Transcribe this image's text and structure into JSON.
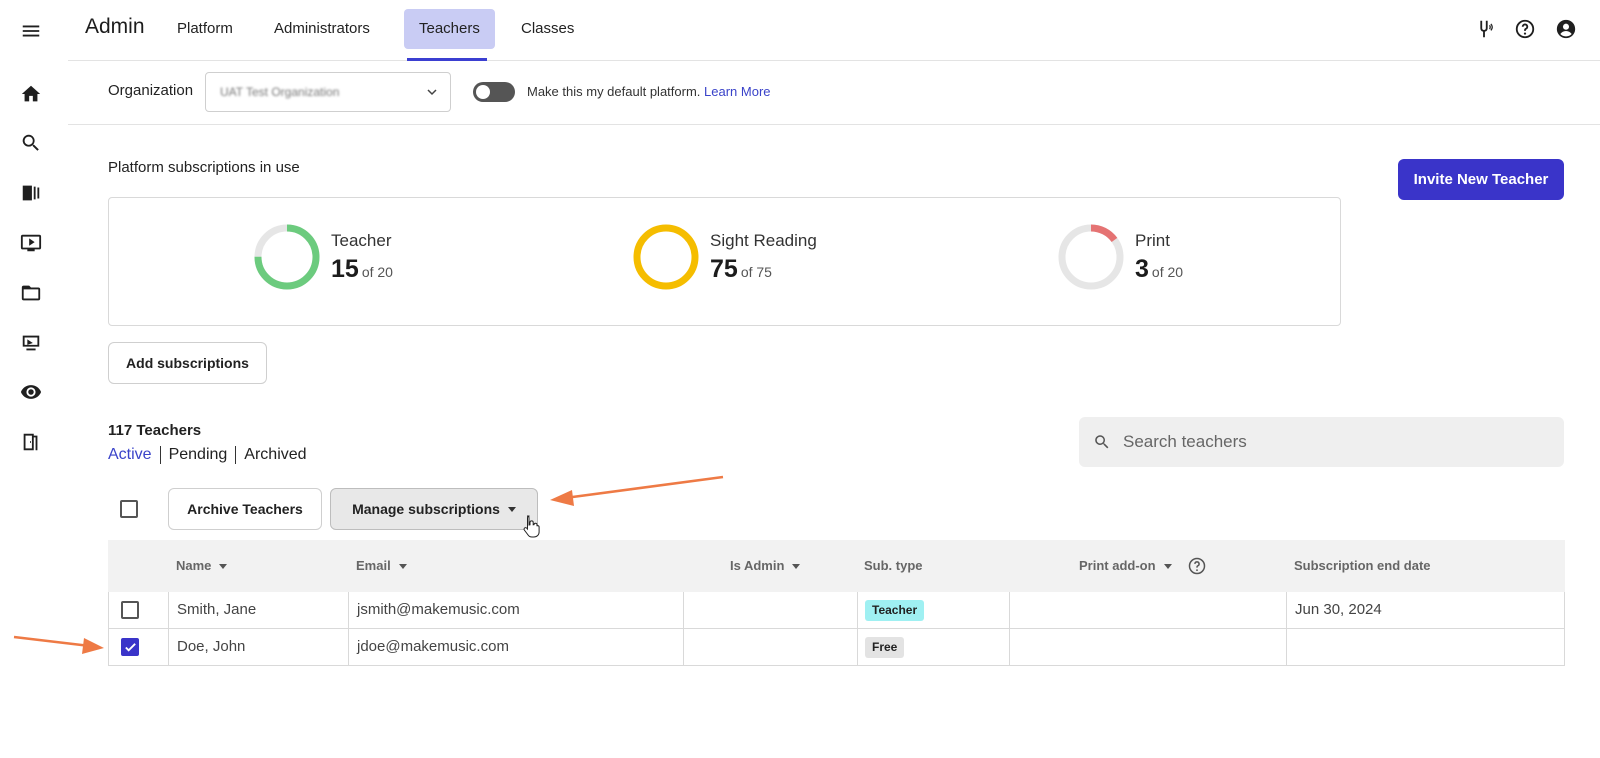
{
  "header": {
    "app_title": "Admin",
    "tabs": [
      {
        "label": "Platform"
      },
      {
        "label": "Administrators"
      },
      {
        "label": "Teachers",
        "active": true
      },
      {
        "label": "Classes"
      }
    ],
    "icons": [
      "tuning-fork-icon",
      "help-icon",
      "account-icon"
    ]
  },
  "sidebar": {
    "icons": [
      "menu-icon",
      "home-icon",
      "search-icon",
      "library-icon",
      "video-icon",
      "folder-icon",
      "classroom-icon",
      "eye-icon",
      "exit-door-icon"
    ]
  },
  "org": {
    "label": "Organization",
    "selected": "UAT Test Organization",
    "default_text": "Make this my default platform.",
    "learn_more": "Learn More",
    "default_toggle_on": false
  },
  "subscriptions": {
    "title": "Platform subscriptions in use",
    "invite_button": "Invite New Teacher",
    "add_button": "Add subscriptions",
    "meters": [
      {
        "name": "Teacher",
        "used": "15",
        "of": "of 20",
        "color": "#6ccb7e"
      },
      {
        "name": "Sight Reading",
        "used": "75",
        "of": "of 75",
        "color": "#f5bd00"
      },
      {
        "name": "Print",
        "used": "3",
        "of": "of 20",
        "color": "#e57373"
      }
    ]
  },
  "teachers": {
    "count_label": "117 Teachers",
    "filters": [
      "Active",
      "Pending",
      "Archived"
    ],
    "search_placeholder": "Search teachers",
    "archive_button": "Archive Teachers",
    "manage_button": "Manage subscriptions",
    "columns": {
      "name": "Name",
      "email": "Email",
      "is_admin": "Is Admin",
      "sub_type": "Sub. type",
      "print_addon": "Print add-on",
      "end_date": "Subscription end date"
    },
    "rows": [
      {
        "name": "Smith, Jane",
        "email": "jsmith@makemusic.com",
        "is_admin": "",
        "sub_type": "Teacher",
        "print_addon": "",
        "end_date": "Jun 30, 2024",
        "checked": false
      },
      {
        "name": "Doe, John",
        "email": "jdoe@makemusic.com",
        "is_admin": "",
        "sub_type": "Free",
        "print_addon": "",
        "end_date": "",
        "checked": true
      }
    ],
    "badge_colors": {
      "Teacher": "#9ff0f2",
      "Free": "#e3e3e3"
    }
  }
}
